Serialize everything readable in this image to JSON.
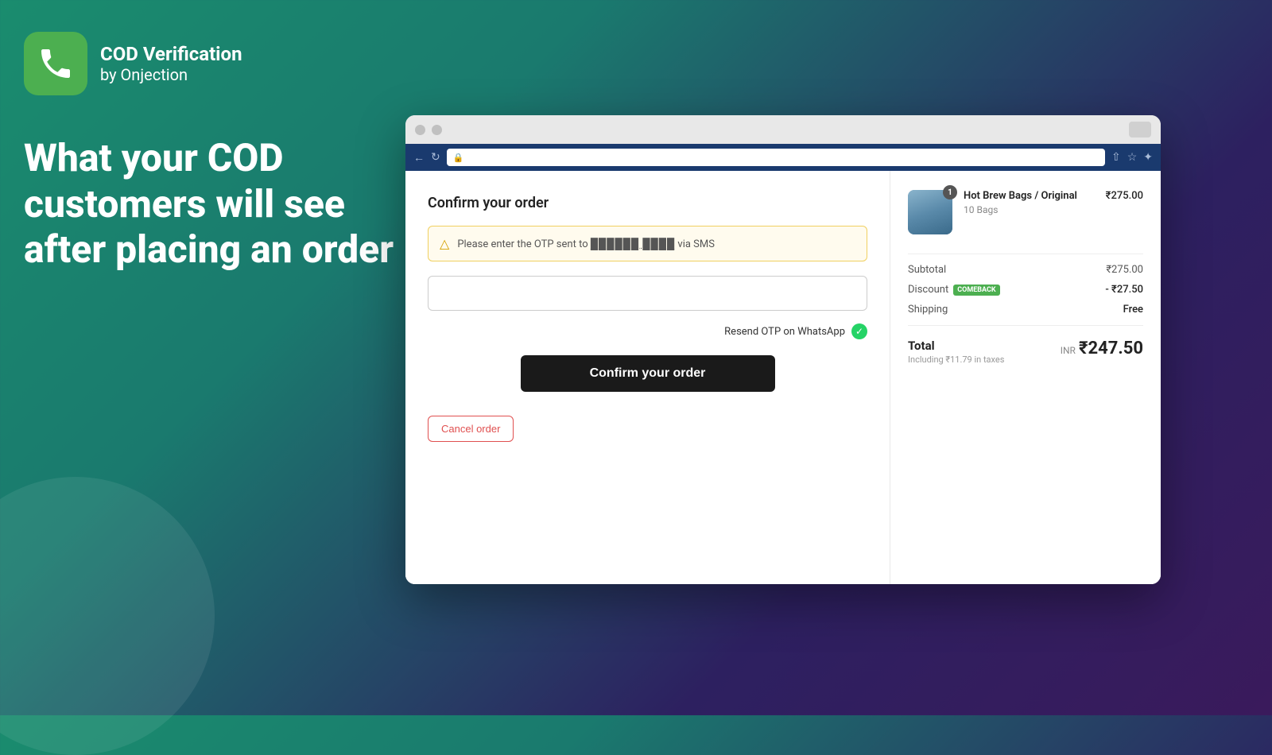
{
  "background": {
    "gradient_start": "#1a8c6e",
    "gradient_end": "#3a1a5c"
  },
  "logo": {
    "title": "COD Verification",
    "subtitle": "by Onjection",
    "icon_label": "phone-icon"
  },
  "headline": {
    "line1": "What your COD",
    "line2": "customers will see",
    "line3": "after placing an order"
  },
  "browser": {
    "dots": [
      "close",
      "minimize"
    ],
    "toolbar_icons": [
      "back-icon",
      "refresh-icon",
      "lock-icon"
    ],
    "toolbar_right_icons": [
      "share-icon",
      "star-icon",
      "extension-icon"
    ]
  },
  "order_panel": {
    "title": "Confirm your order",
    "otp_notice": "Please enter the OTP sent to ██████ ████ via SMS",
    "otp_notice_masked": "██████ ████",
    "otp_placeholder": "",
    "resend_label": "Resend OTP on WhatsApp",
    "confirm_button": "Confirm your order",
    "cancel_button": "Cancel order"
  },
  "summary_panel": {
    "product": {
      "name": "Hot Brew Bags / Original",
      "variant": "10 Bags",
      "price": "₹275.00",
      "badge": "1",
      "img_alt": "product-image"
    },
    "subtotal_label": "Subtotal",
    "subtotal_value": "₹275.00",
    "discount_label": "Discount",
    "discount_code": "COMEBACK",
    "discount_value": "- ₹27.50",
    "shipping_label": "Shipping",
    "shipping_value": "Free",
    "total_label": "Total",
    "total_tax_note": "Including ₹11.79 in taxes",
    "total_currency": "INR",
    "total_value": "₹247.50"
  }
}
